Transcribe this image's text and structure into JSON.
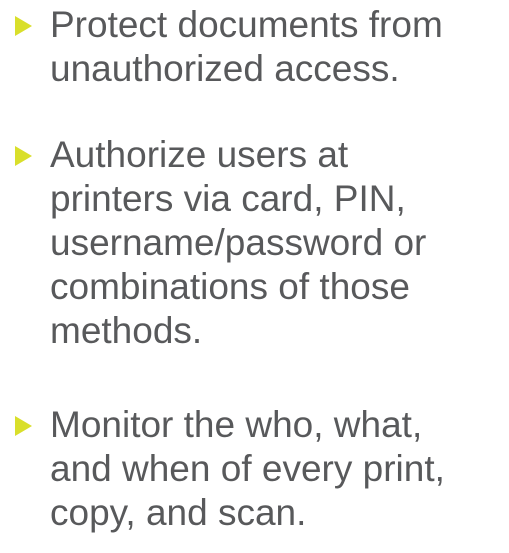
{
  "bullet_color": "#d9df2b",
  "text_color": "#58595b",
  "icon": "triangle-bullet-icon",
  "bullets": [
    {
      "lines": [
        "Protect documents from",
        "unauthorized access."
      ]
    },
    {
      "lines": [
        "Authorize users at",
        "printers via card, PIN,",
        "username/password or",
        "combinations of those",
        "methods."
      ]
    },
    {
      "lines": [
        "Monitor the who, what,",
        "and when of every print,",
        "copy, and scan."
      ]
    }
  ]
}
